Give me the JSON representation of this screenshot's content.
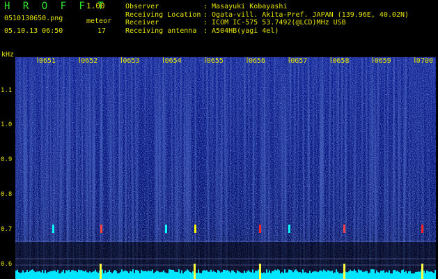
{
  "app": {
    "title": "H R O F F T",
    "version": "1.00"
  },
  "file": {
    "name": "0510130650.png",
    "datetime": "05.10.13 06:50"
  },
  "meteor": {
    "label": "meteor",
    "count": "17"
  },
  "info": [
    {
      "key": "Observer",
      "value": ": Masayuki Kobayashi"
    },
    {
      "key": "Receiving Location",
      "value": ": Ogata-vill. Akita-Pref. JAPAN (139.96E, 40.02N)"
    },
    {
      "key": "Receiver",
      "value": ": ICOM IC-575 53.7492(@LCD)MHz USB"
    },
    {
      "key": "Receiving antenna",
      "value": ": A504HB(yagi 4el)"
    }
  ],
  "spectrogram": {
    "unit": "kHz",
    "freq_ticks": [
      "1.1",
      "1.0",
      "0.9",
      "0.8",
      "0.7",
      "0.6"
    ],
    "time_ticks": [
      "0651",
      "0652",
      "0653",
      "0654",
      "0655",
      "0656",
      "0657",
      "0658",
      "0659",
      "0700"
    ],
    "colors": {
      "background": "#000000",
      "noise": "#1a2fb4",
      "signal": "#00ffff",
      "peak": "#ff2020",
      "label": "#e6e600"
    }
  }
}
